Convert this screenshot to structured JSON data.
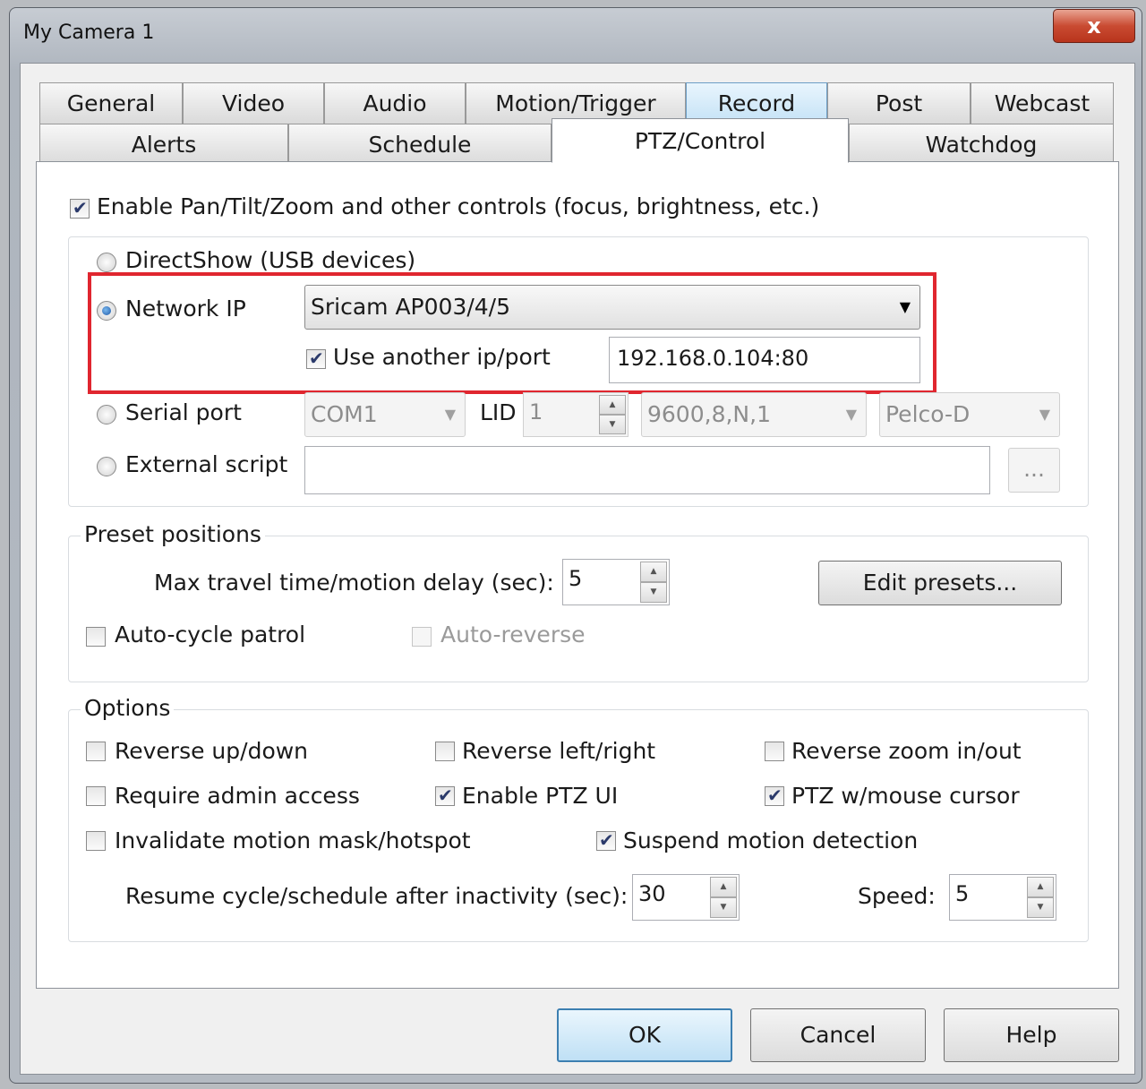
{
  "window": {
    "title": "My Camera 1",
    "close_glyph": "x"
  },
  "tabs": {
    "row1": [
      "General",
      "Video",
      "Audio",
      "Motion/Trigger",
      "Record",
      "Post",
      "Webcast"
    ],
    "row2": [
      "Alerts",
      "Schedule",
      "PTZ/Control",
      "Watchdog"
    ],
    "active": "PTZ/Control"
  },
  "ptz": {
    "enable_label": "Enable Pan/Tilt/Zoom and other controls (focus, brightness, etc.)",
    "enable_checked": true,
    "directshow_label": "DirectShow (USB devices)",
    "network_ip_label": "Network IP",
    "network_ip_selected": true,
    "network_model": "Sricam AP003/4/5",
    "use_another_label": "Use another ip/port",
    "use_another_checked": true,
    "ip_port_value": "192.168.0.104:80",
    "serial_port_label": "Serial port",
    "com_value": "COM1",
    "lid_label": "LID",
    "lid_value": "1",
    "baud_value": "9600,8,N,1",
    "protocol_value": "Pelco-D",
    "external_script_label": "External script",
    "external_script_value": "",
    "browse_label": "..."
  },
  "presets": {
    "legend": "Preset positions",
    "max_travel_label": "Max travel time/motion delay (sec):",
    "max_travel_value": "5",
    "edit_button": "Edit presets...",
    "auto_cycle_label": "Auto-cycle patrol",
    "auto_reverse_label": "Auto-reverse"
  },
  "options": {
    "legend": "Options",
    "reverse_updown": "Reverse up/down",
    "reverse_leftright": "Reverse left/right",
    "reverse_zoom": "Reverse zoom in/out",
    "require_admin": "Require admin access",
    "enable_ptz_ui": "Enable PTZ UI",
    "ptz_mouse": "PTZ w/mouse cursor",
    "invalidate_mask": "Invalidate motion mask/hotspot",
    "suspend_motion": "Suspend motion detection",
    "resume_label": "Resume cycle/schedule after inactivity (sec):",
    "resume_value": "30",
    "speed_label": "Speed:",
    "speed_value": "5"
  },
  "footer": {
    "ok": "OK",
    "cancel": "Cancel",
    "help": "Help"
  },
  "colors": {
    "highlight_box": "#e0262f",
    "default_button_border": "#3c7fb1"
  }
}
